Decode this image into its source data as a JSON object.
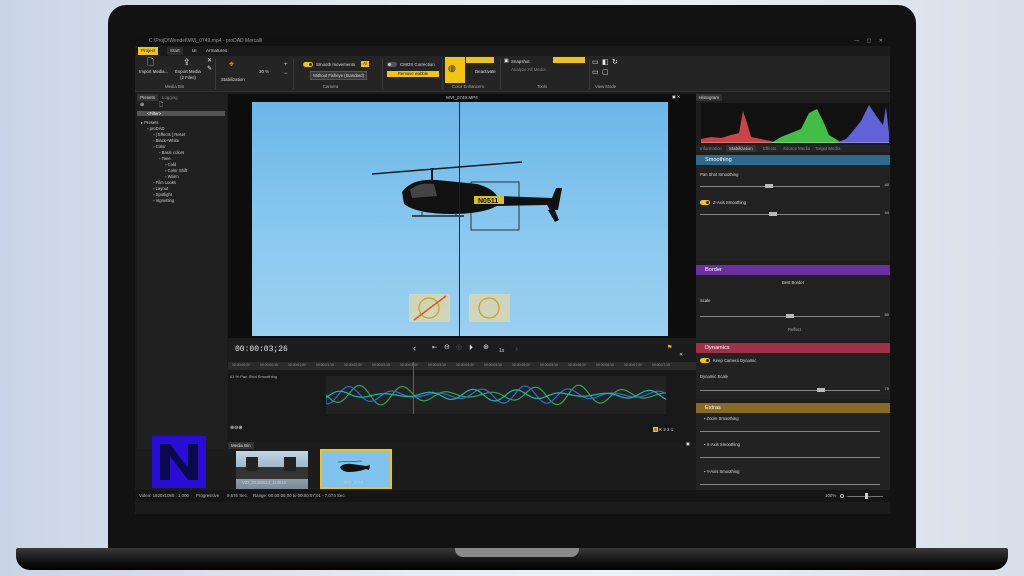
{
  "titlebar": {
    "path": "C:\\ProjD\\Wendel\\MVI_0749.mp4 - proDAD Mercalli",
    "controls": "—  ▢  ✕"
  },
  "tabs": [
    {
      "label": "Project"
    },
    {
      "label": "Start"
    },
    {
      "label": "UI"
    },
    {
      "label": "Armatures"
    }
  ],
  "ribbon": {
    "import_label": "Import Media...",
    "export_label": "Export Media",
    "export_sub": "(2 Files)",
    "media_bin_group": "Media Bin",
    "stabilization_label": "Stabilization",
    "zoom_value": "30 %",
    "smooth_movements": "Smooth movements",
    "smooth_badge": "Al",
    "fisheye_select": "Without Fisheye (Standard)",
    "camera_group": "Camera",
    "cmos_label": "CMOS Correction",
    "remove_wobble": "Remove wobble",
    "color_group": "Color Enhancers",
    "deactivate_label": "Deactivate",
    "snapshot_label": "Snapshot",
    "analyze_label": "Analyze All Media",
    "tools_group": "Tools",
    "view_group": "View Mode"
  },
  "presets_panel": {
    "tabs": [
      "Presets",
      "Logging"
    ],
    "search_value": "<Filter>",
    "tree": [
      {
        "label": "Presets",
        "indent": 0
      },
      {
        "label": "proDAD",
        "indent": 1
      },
      {
        "label": "[ Effects ] Reset",
        "indent": 2
      },
      {
        "label": "Black+White",
        "indent": 2
      },
      {
        "label": "Color",
        "indent": 2
      },
      {
        "label": "Basic colors",
        "indent": 3
      },
      {
        "label": "Tone",
        "indent": 3
      },
      {
        "label": "Cold",
        "indent": 4
      },
      {
        "label": "Color Shift",
        "indent": 4
      },
      {
        "label": "Warm",
        "indent": 4
      },
      {
        "label": "Film Looks",
        "indent": 2
      },
      {
        "label": "Layout",
        "indent": 2
      },
      {
        "label": "Spotlight",
        "indent": 2
      },
      {
        "label": "Vignetting",
        "indent": 2
      }
    ]
  },
  "video": {
    "title": "MVI_0749.MP4",
    "tail_number": "N0511"
  },
  "transport": {
    "timecode": "00:00:03;26",
    "speed": "1x"
  },
  "timeline": {
    "ticks": [
      "00:00:00;00",
      "00:00:00;15",
      "00:00:01;00",
      "00:00:01;15",
      "00:00:02;00",
      "00:00:02;15",
      "00:00:03;00",
      "00:00:03;15",
      "00:00:04;00",
      "00:00:04;15",
      "00:00:05;00",
      "00:00:05;15",
      "00:00:06;00",
      "00:00:06;15",
      "00:00:07;00",
      "00:00:07;15"
    ],
    "track_label": "#1 % Pan Shot Smoothing",
    "keys": [
      "1",
      "2",
      "3",
      "S"
    ]
  },
  "media_bin": {
    "tab": "Media Bin",
    "items": [
      {
        "label": "VID_20180514_113012"
      },
      {
        "label": "MVI_0749"
      }
    ]
  },
  "statusbar": {
    "video_info": "Video: 1920x1080 : 1,000",
    "scan": "Progressive",
    "duration": "9,676 Sec.",
    "range": "Range: 00:00:00;00 to 00:00:07;01 - 7,074 Sec.",
    "zoom": "100%"
  },
  "right_panel": {
    "histogram_tab": "Histogram",
    "tabs": [
      "Information",
      "Stabilization",
      "Effects",
      "Source Media",
      "Target Media"
    ],
    "sections": {
      "smoothing": {
        "title": "Smoothing",
        "color": "#2d6a8c",
        "rows": [
          {
            "label": "Pan Shot Smoothing",
            "value": "40",
            "level": 0.38,
            "toggle": false
          },
          {
            "label": "Z-Axis Smoothing",
            "value": "44",
            "level": 0.4,
            "toggle": true
          }
        ]
      },
      "border": {
        "title": "Border",
        "color": "#6a2fa0",
        "best_border": "Best Border",
        "scale_label": "Scale",
        "scale_value": "50",
        "scale_level": 0.5,
        "reflect": "Reflect"
      },
      "dynamics": {
        "title": "Dynamics",
        "color": "#a0304a",
        "keep_label": "Keep Camera Dynamic",
        "scale_label": "Dynamic Scale",
        "scale_value": "75",
        "scale_level": 0.68
      },
      "extras": {
        "title": "Extras",
        "color": "#8a6a22",
        "rows": [
          {
            "label": "Zoom Smoothing",
            "value": "",
            "level": 0.5
          },
          {
            "label": "X-Axis Smoothing",
            "value": "",
            "level": 0.5
          },
          {
            "label": "Y-Axis Smoothing",
            "value": "",
            "level": 0.5
          }
        ]
      }
    }
  },
  "colors": {
    "accent": "#f1c40f",
    "sky": "#7fc3ee",
    "logo": "#2b0bd6"
  }
}
